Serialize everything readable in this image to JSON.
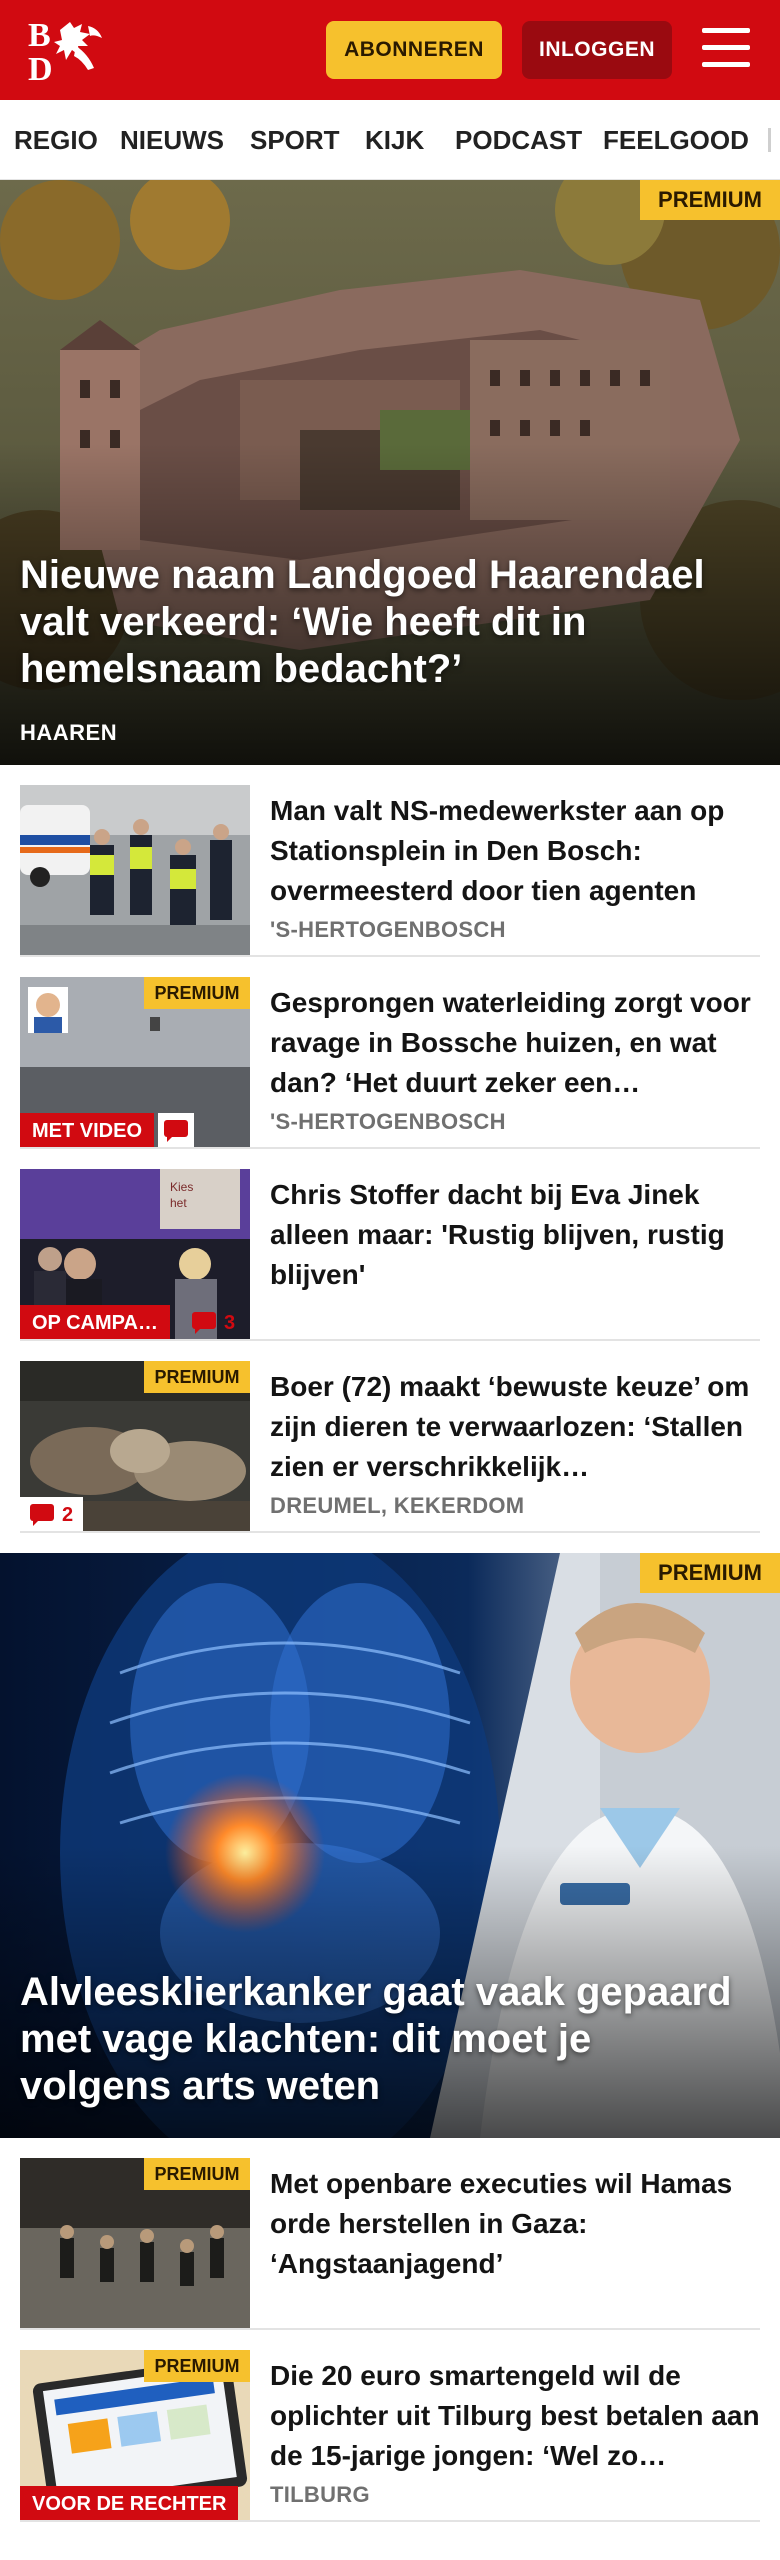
{
  "header": {
    "logo_text": "BD",
    "subscribe_label": "ABONNEREN",
    "login_label": "INLOGGEN",
    "menu_icon": "hamburger-menu-icon",
    "brand_red": "#d10a11",
    "accent_yellow": "#f6c12d"
  },
  "nav": {
    "items": [
      "REGIO",
      "NIEUWS",
      "SPORT",
      "KIJK",
      "PODCAST",
      "FEELGOOD"
    ]
  },
  "hero1": {
    "premium": "PREMIUM",
    "title": "Nieuwe naam Landgoed Haarendael valt verkeerd: ‘Wie heeft dit in hemelsnaam bedacht?’",
    "location": "HAAREN"
  },
  "articles": [
    {
      "title": "Man valt NS-medewerkster aan op Stationsplein in Den Bosch: overmeesterd door tien agenten",
      "location": "'S-HERTOGENBOSCH"
    },
    {
      "premium": "PREMIUM",
      "label": "MET VIDEO",
      "title": "Gesprongen waterleiding zorgt voor ravage in Bossche huizen, en wat dan? ‘Het duurt zeker een…",
      "location": "'S-HERTOGENBOSCH"
    },
    {
      "label": "OP CAMPA…",
      "comments": "3",
      "title": "Chris Stoffer dacht bij Eva Jinek alleen maar: 'Rustig blijven, rustig blijven'"
    },
    {
      "premium": "PREMIUM",
      "comments": "2",
      "title": "Boer (72) maakt ‘bewuste keuze’ om zijn dieren te verwaarlozen: ‘Stallen zien er verschrikkelijk…",
      "location": "DREUMEL, KEKERDOM"
    }
  ],
  "hero2": {
    "premium": "PREMIUM",
    "title": "Alvleesklierkanker gaat vaak gepaard met vage klachten: dit moet je volgens arts weten"
  },
  "articles2": [
    {
      "premium": "PREMIUM",
      "title": "Met openbare executies wil Hamas orde herstellen in Gaza: ‘Angstaanjagend’"
    },
    {
      "premium": "PREMIUM",
      "label": "VOOR DE RECHTER",
      "title": "Die 20 euro smartengeld wil de oplichter uit Tilburg best betalen aan de 15-jarige jongen: ‘Wel zo…",
      "location": "TILBURG"
    }
  ]
}
